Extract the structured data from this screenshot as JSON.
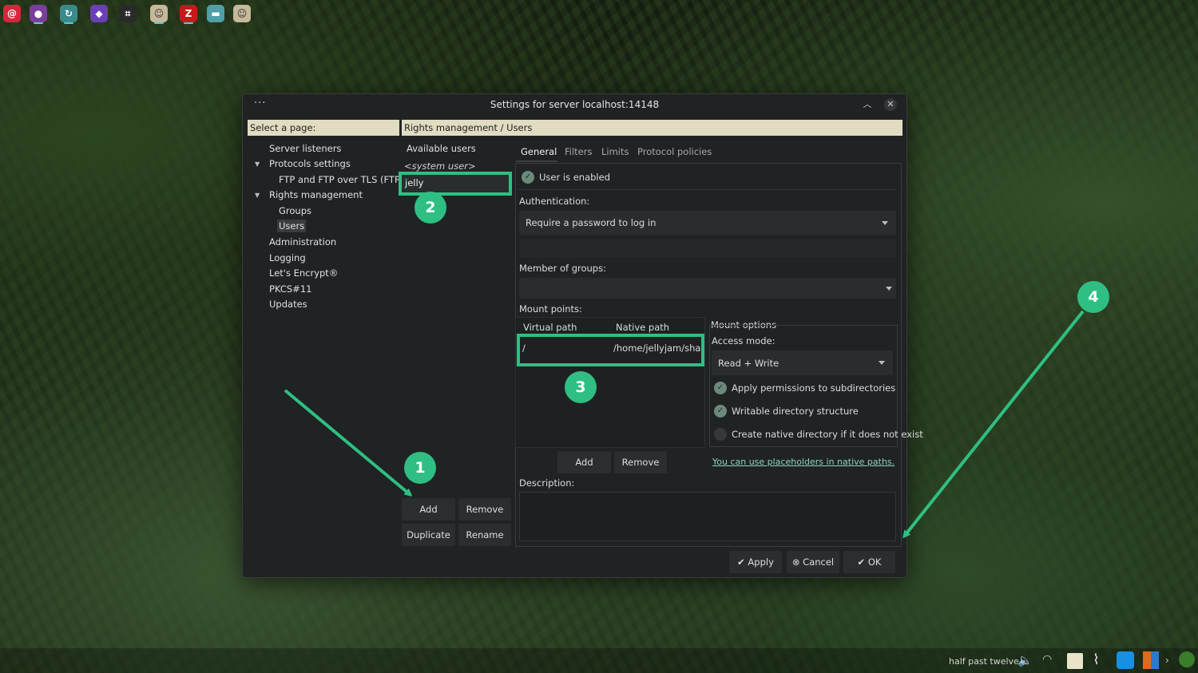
{
  "dialog": {
    "title": "Settings for server localhost:14148",
    "menu_glyph": "···",
    "min_glyph": "︿",
    "close_glyph": "✕"
  },
  "headers": {
    "left": "Select a page:",
    "right": "Rights management / Users"
  },
  "tree": {
    "items": [
      {
        "label": "Server listeners"
      },
      {
        "label": "Protocols settings"
      },
      {
        "label": "FTP and FTP over TLS (FTPS)"
      },
      {
        "label": "Rights management"
      },
      {
        "label": "Groups"
      },
      {
        "label": "Users"
      },
      {
        "label": "Administration"
      },
      {
        "label": "Logging"
      },
      {
        "label": "Let's Encrypt®"
      },
      {
        "label": "PKCS#11"
      },
      {
        "label": "Updates"
      }
    ]
  },
  "users": {
    "title": "Available users",
    "system_user": "<system user>",
    "selected": "jelly",
    "buttons": {
      "add": "Add",
      "remove": "Remove",
      "duplicate": "Duplicate",
      "rename": "Rename"
    }
  },
  "tabs": [
    "General",
    "Filters",
    "Limits",
    "Protocol policies"
  ],
  "general": {
    "user_enabled": "User is enabled",
    "auth_label": "Authentication:",
    "auth_value": "Require a password to log in",
    "groups_label": "Member of groups:",
    "mount_label": "Mount points:",
    "col_virtual": "Virtual path",
    "col_native": "Native path",
    "mount_virtual": "/",
    "mount_native": "/home/jellyjam/shar",
    "mount_add": "Add",
    "mount_remove": "Remove",
    "placeholders_link": "You can use placeholders in native paths.",
    "description_label": "Description:"
  },
  "mount_options": {
    "title": "Mount options",
    "access_label": "Access mode:",
    "access_value": "Read + Write",
    "opt1": "Apply permissions to subdirectories",
    "opt2": "Writable directory structure",
    "opt3": "Create native directory if it does not exist"
  },
  "footer": {
    "apply": "Apply",
    "cancel": "Cancel",
    "ok": "OK"
  },
  "annotations": [
    "1",
    "2",
    "3",
    "4"
  ],
  "annotation_color": "#2fbf82",
  "taskbar": {
    "clock": "half past twelve",
    "icons": [
      "debian-icon",
      "firefox-icon",
      "sync-icon",
      "obsidian-icon",
      "screenshot-icon",
      "cat-icon",
      "filezilla-icon",
      "files-icon",
      "cat-icon-2"
    ]
  }
}
